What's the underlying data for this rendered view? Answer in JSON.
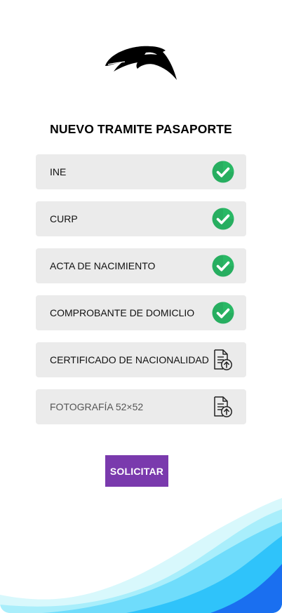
{
  "header": {
    "title": "NUEVO TRAMITE PASAPORTE"
  },
  "documents": [
    {
      "label": "INE",
      "status": "complete",
      "icon": "check-circle-icon"
    },
    {
      "label": "CURP",
      "status": "complete",
      "icon": "check-circle-icon"
    },
    {
      "label": "ACTA DE NACIMIENTO",
      "status": "complete",
      "icon": "check-circle-icon"
    },
    {
      "label": "COMPROBANTE DE DOMICLIO",
      "status": "complete",
      "icon": "check-circle-icon"
    },
    {
      "label": "CERTIFICADO DE NACIONALIDAD",
      "status": "pending",
      "icon": "file-upload-icon"
    },
    {
      "label": "FOTOGRAFÍA 52×52",
      "status": "pending",
      "icon": "file-upload-icon"
    }
  ],
  "actions": {
    "submit_label": "SOLICITAR"
  },
  "colors": {
    "accent": "#7a3aad",
    "success": "#27ae60",
    "row_background": "#ebebeb",
    "wave_light": "#bff3fb",
    "wave_mid": "#4fd3fa",
    "wave_dark": "#1a6ff0"
  },
  "icons": {
    "logo": "dolphin-logo",
    "complete": "check-circle-icon",
    "pending": "file-upload-icon"
  }
}
